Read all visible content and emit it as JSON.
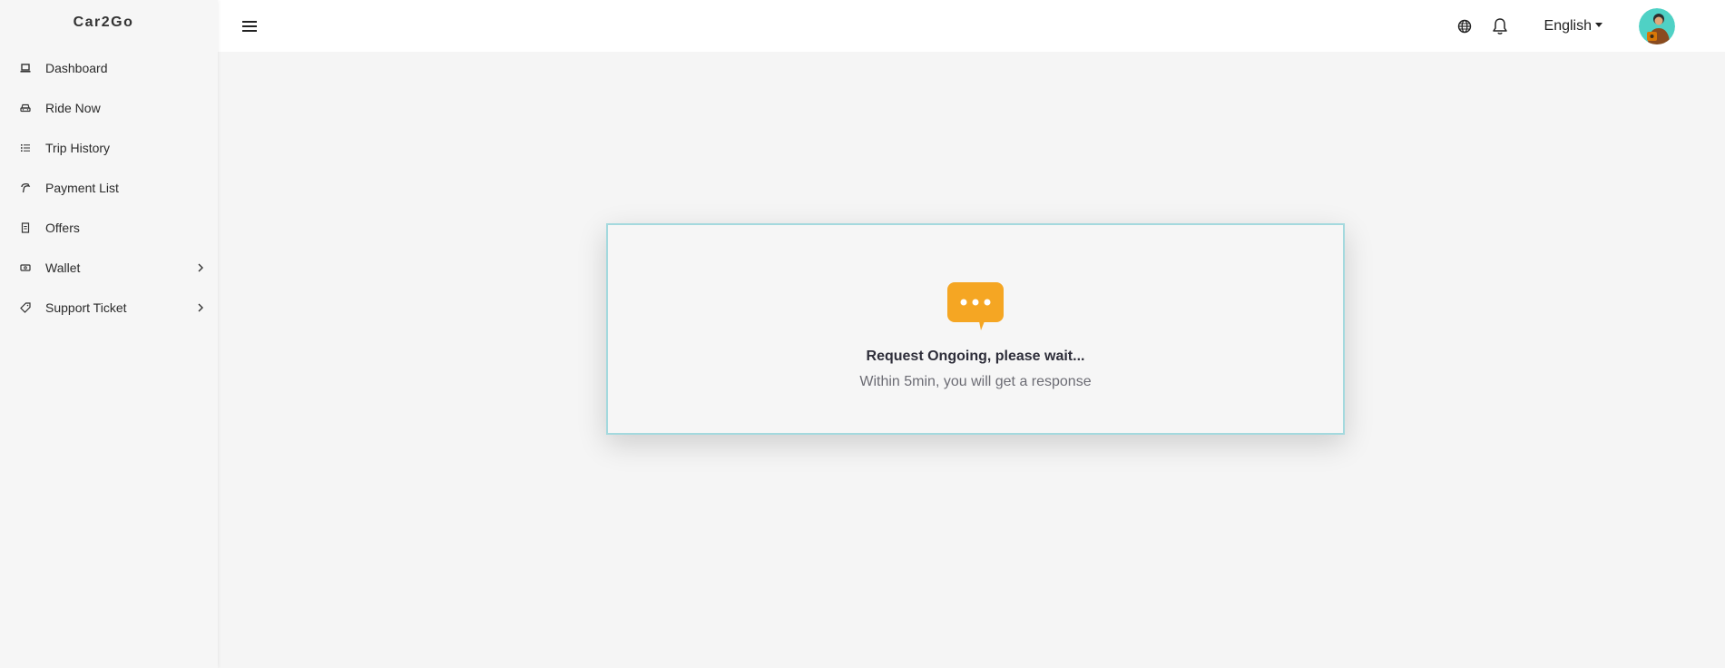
{
  "app": {
    "brand": "Car2Go"
  },
  "sidebar": {
    "items": [
      {
        "label": "Dashboard",
        "icon": "laptop-icon",
        "has_submenu": false
      },
      {
        "label": "Ride Now",
        "icon": "car-icon",
        "has_submenu": false
      },
      {
        "label": "Trip History",
        "icon": "list-icon",
        "has_submenu": false
      },
      {
        "label": "Payment List",
        "icon": "payment-icon",
        "has_submenu": false
      },
      {
        "label": "Offers",
        "icon": "receipt-icon",
        "has_submenu": false
      },
      {
        "label": "Wallet",
        "icon": "wallet-icon",
        "has_submenu": true
      },
      {
        "label": "Support Ticket",
        "icon": "ticket-icon",
        "has_submenu": true
      }
    ]
  },
  "header": {
    "menu_icon": "hamburger-icon",
    "globe_icon": "globe-icon",
    "bell_icon": "bell-icon",
    "language": "English"
  },
  "status": {
    "title": "Request Ongoing, please wait...",
    "subtitle": "Within 5min, you will get a response",
    "icon": "chat-bubble-icon"
  },
  "colors": {
    "accent": "#f5a623",
    "card_border": "#a4d9de",
    "background": "#f5f5f5"
  }
}
